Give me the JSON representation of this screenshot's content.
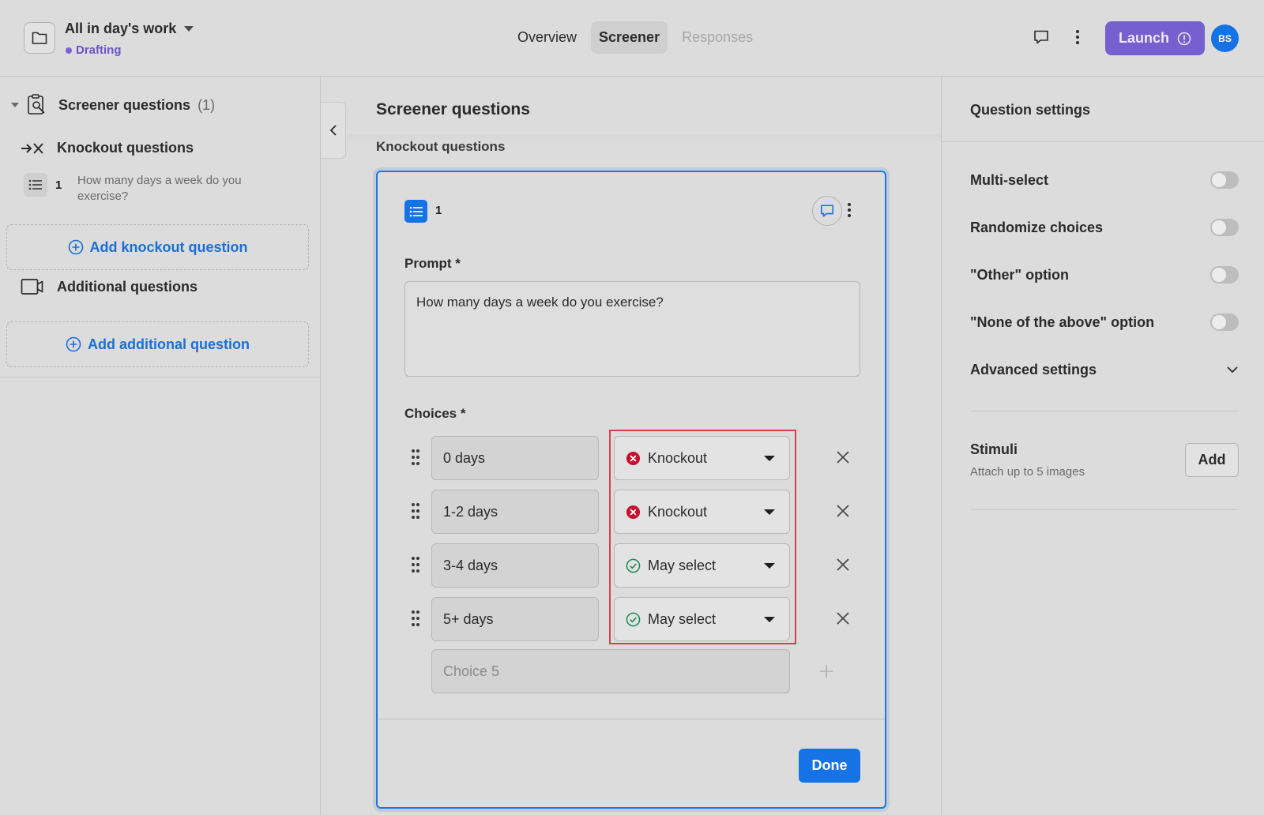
{
  "header": {
    "project_title": "All in day's work",
    "status": "Drafting",
    "tabs": [
      {
        "label": "Overview",
        "state": "normal"
      },
      {
        "label": "Screener",
        "state": "active"
      },
      {
        "label": "Responses",
        "state": "disabled"
      }
    ],
    "launch_label": "Launch",
    "avatar_initials": "BS"
  },
  "sidebar": {
    "section_title": "Screener questions",
    "section_count": "(1)",
    "knockout_title": "Knockout questions",
    "question": {
      "number": "1",
      "text": "How many days a week do you exercise?"
    },
    "add_knockout_label": "Add knockout question",
    "additional_title": "Additional questions",
    "add_additional_label": "Add additional question"
  },
  "main": {
    "title": "Screener questions",
    "section_label": "Knockout questions",
    "card": {
      "number": "1",
      "prompt_label": "Prompt *",
      "prompt_value": "How many days a week do you exercise?",
      "choices_label": "Choices *",
      "choices": [
        {
          "value": "0 days",
          "rule": "Knockout",
          "rule_type": "knockout"
        },
        {
          "value": "1-2 days",
          "rule": "Knockout",
          "rule_type": "knockout"
        },
        {
          "value": "3-4 days",
          "rule": "May select",
          "rule_type": "may"
        },
        {
          "value": "5+ days",
          "rule": "May select",
          "rule_type": "may"
        }
      ],
      "new_choice_placeholder": "Choice 5",
      "done_label": "Done"
    }
  },
  "settings": {
    "title": "Question settings",
    "toggles": [
      {
        "label": "Multi-select",
        "on": false
      },
      {
        "label": "Randomize choices",
        "on": false
      },
      {
        "label": "\"Other\" option",
        "on": false
      },
      {
        "label": "\"None of the above\" option",
        "on": false
      }
    ],
    "advanced_label": "Advanced settings",
    "stimuli_title": "Stimuli",
    "stimuli_sub": "Attach up to 5 images",
    "add_label": "Add"
  },
  "colors": {
    "accent": "#1573e6",
    "launch": "#7460cf",
    "knockout": "#c8102e",
    "may_select": "#1e8a5a",
    "highlight": "#d8414a"
  }
}
